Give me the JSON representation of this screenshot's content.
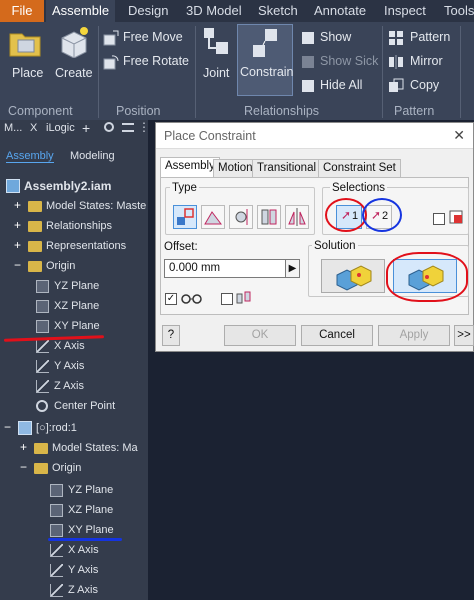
{
  "ribbon": {
    "tabs": [
      "File",
      "Assemble",
      "Design",
      "3D Model",
      "Sketch",
      "Annotate",
      "Inspect",
      "Tools"
    ],
    "active_tab": "Assemble",
    "buttons": {
      "place": "Place",
      "create": "Create",
      "free_move": "Free Move",
      "free_rotate": "Free Rotate",
      "joint": "Joint",
      "constrain": "Constrain",
      "show": "Show",
      "show_sick": "Show Sick",
      "hide_all": "Hide All",
      "pattern": "Pattern",
      "mirror": "Mirror",
      "copy": "Copy"
    },
    "groups": {
      "component": "Component",
      "position": "Position",
      "relationships": "Relationships",
      "pattern": "Pattern"
    }
  },
  "browser": {
    "header": {
      "model_tab": "M...",
      "close": "X",
      "ilogic": "iLogic",
      "add": "+"
    },
    "modes": {
      "assembly": "Assembly",
      "modeling": "Modeling"
    },
    "tree": [
      "Assembly2.iam",
      "Model States: Maste",
      "Relationships",
      "Representations",
      "Origin",
      "YZ Plane",
      "XZ Plane",
      "XY Plane",
      "X Axis",
      "Y Axis",
      "Z Axis",
      "Center Point",
      "[○]:rod:1",
      "Model States: Ma",
      "Origin",
      "YZ Plane",
      "XZ Plane",
      "XY Plane",
      "X Axis",
      "Y Axis",
      "Z Axis"
    ]
  },
  "dialog": {
    "title": "Place Constraint",
    "tabs": [
      "Assembly",
      "Motion",
      "Transitional",
      "Constraint Set"
    ],
    "type_label": "Type",
    "selections_label": "Selections",
    "sel1": "1",
    "sel2": "2",
    "offset_label": "Offset:",
    "offset_value": "0.000 mm",
    "solution_label": "Solution",
    "help": "?",
    "ok": "OK",
    "cancel": "Cancel",
    "apply": "Apply",
    "more": ">>"
  }
}
